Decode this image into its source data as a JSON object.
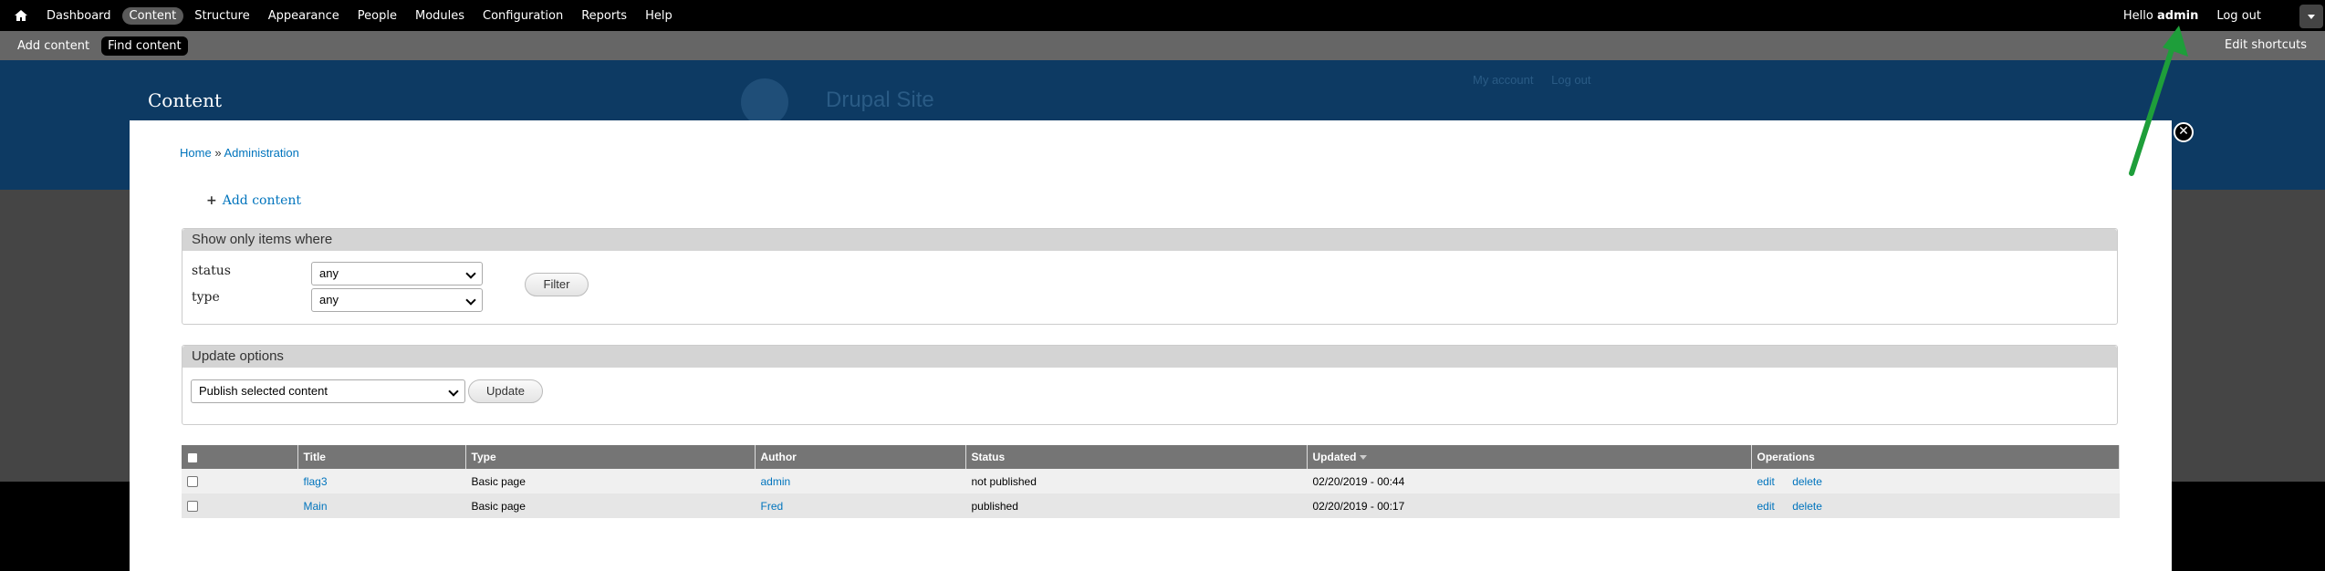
{
  "toolbar": {
    "menu": [
      "Dashboard",
      "Content",
      "Structure",
      "Appearance",
      "People",
      "Modules",
      "Configuration",
      "Reports",
      "Help"
    ],
    "active_item": "Content",
    "hello": "Hello",
    "username": "admin",
    "logout": "Log out"
  },
  "shortcuts": {
    "add_content": "Add content",
    "find_content": "Find content",
    "edit_shortcuts": "Edit shortcuts"
  },
  "site": {
    "name": "Drupal Site",
    "my_account": "My account",
    "logout": "Log out"
  },
  "overlay": {
    "title": "Content",
    "close_symbol": "✕"
  },
  "breadcrumb": {
    "home": "Home",
    "separator": "»",
    "administration": "Administration"
  },
  "add_content_link": "Add content",
  "filter": {
    "legend": "Show only items where",
    "status_label": "status",
    "status_value": "any",
    "type_label": "type",
    "type_value": "any",
    "filter_button": "Filter"
  },
  "update": {
    "legend": "Update options",
    "selected_option": "Publish selected content",
    "update_button": "Update"
  },
  "table": {
    "headers": [
      "Title",
      "Type",
      "Author",
      "Status",
      "Updated",
      "Operations"
    ],
    "rows": [
      {
        "title": "flag3",
        "type": "Basic page",
        "author": "admin",
        "status": "not published",
        "updated": "02/20/2019 - 00:44",
        "edit": "edit",
        "delete": "delete"
      },
      {
        "title": "Main",
        "type": "Basic page",
        "author": "Fred",
        "status": "published",
        "updated": "02/20/2019 - 00:17",
        "edit": "edit",
        "delete": "delete"
      }
    ]
  },
  "colors": {
    "toolbar_bg": "#000000",
    "shortcuts_bg": "#666666",
    "link": "#0074bd",
    "site_header": "#0d3a63",
    "annotation_arrow": "#1e9e3a"
  },
  "icons": [
    "home-icon",
    "plus-icon",
    "close-icon",
    "chevron-down-icon",
    "sort-desc-icon"
  ]
}
